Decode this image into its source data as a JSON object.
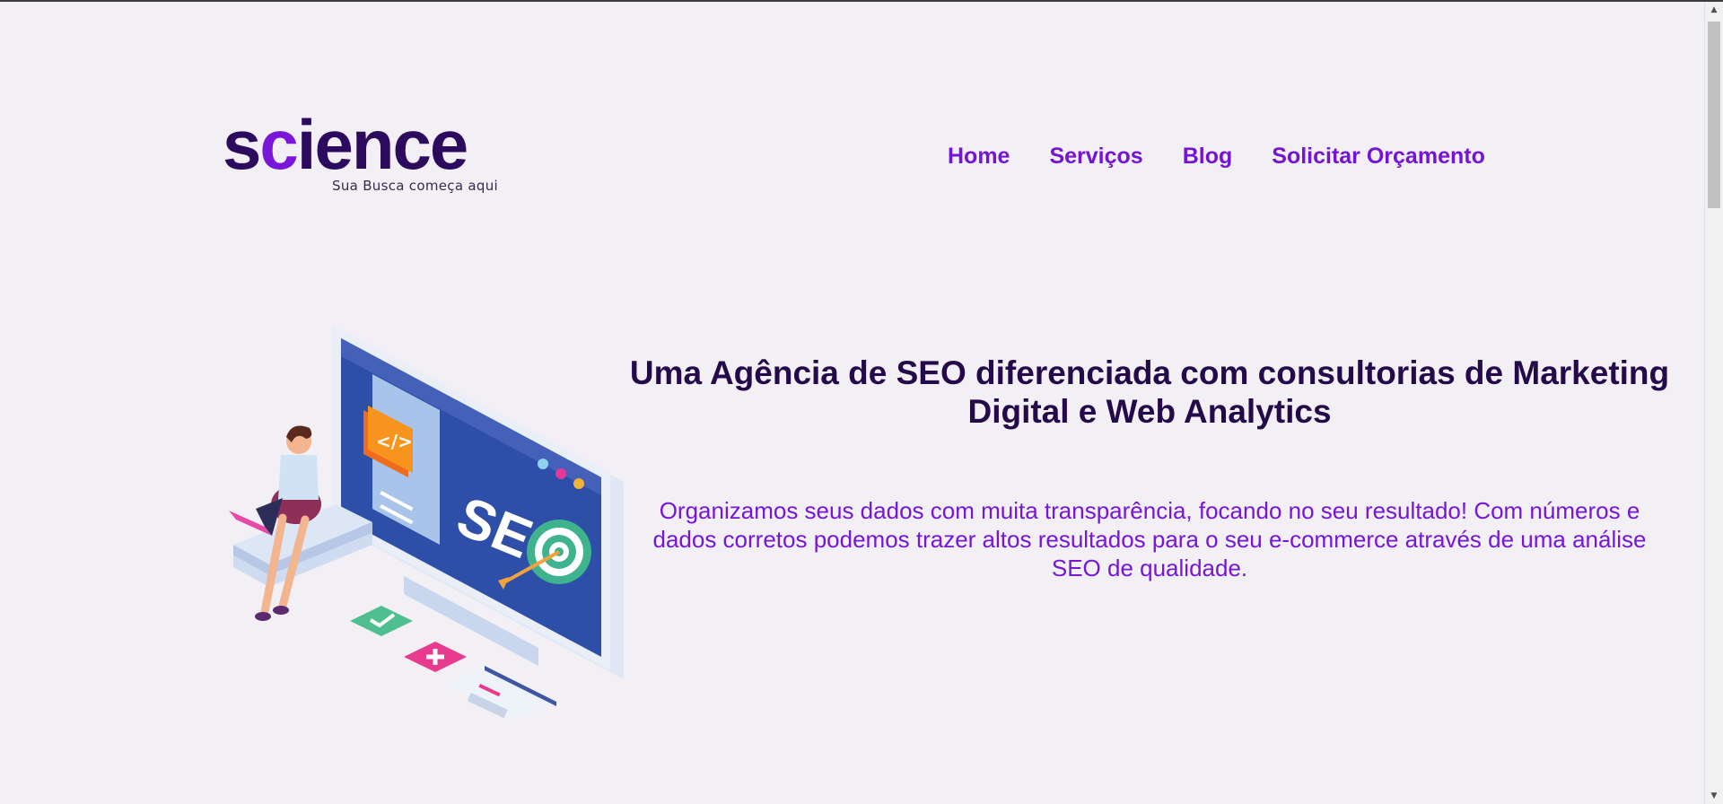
{
  "header": {
    "logo": {
      "word_start": "s",
      "word_accent": "c",
      "word_end": "ience",
      "tagline": "Sua Busca começa aqui"
    },
    "nav": [
      {
        "label": "Home"
      },
      {
        "label": "Serviços"
      },
      {
        "label": "Blog"
      },
      {
        "label": "Solicitar Orçamento"
      }
    ]
  },
  "hero": {
    "title": "Uma Agência de SEO diferenciada com consultorias de Marketing Digital e Web Analytics",
    "text": "Organizamos seus dados com muita transparência, focando no seu resultado! Com números e dados corretos podemos trazer altos resultados para o seu e-commerce através de uma análise SEO de qualidade.",
    "illustration": {
      "screen_label": "SEO",
      "code_badge": "</>"
    }
  },
  "colors": {
    "background": "#f2eff5",
    "brand_dark": "#2c0a5e",
    "brand_purple": "#7414d4",
    "title": "#240a4a"
  },
  "scrollbar": {
    "up_icon": "arrow-up-icon",
    "down_icon": "arrow-down-icon"
  }
}
